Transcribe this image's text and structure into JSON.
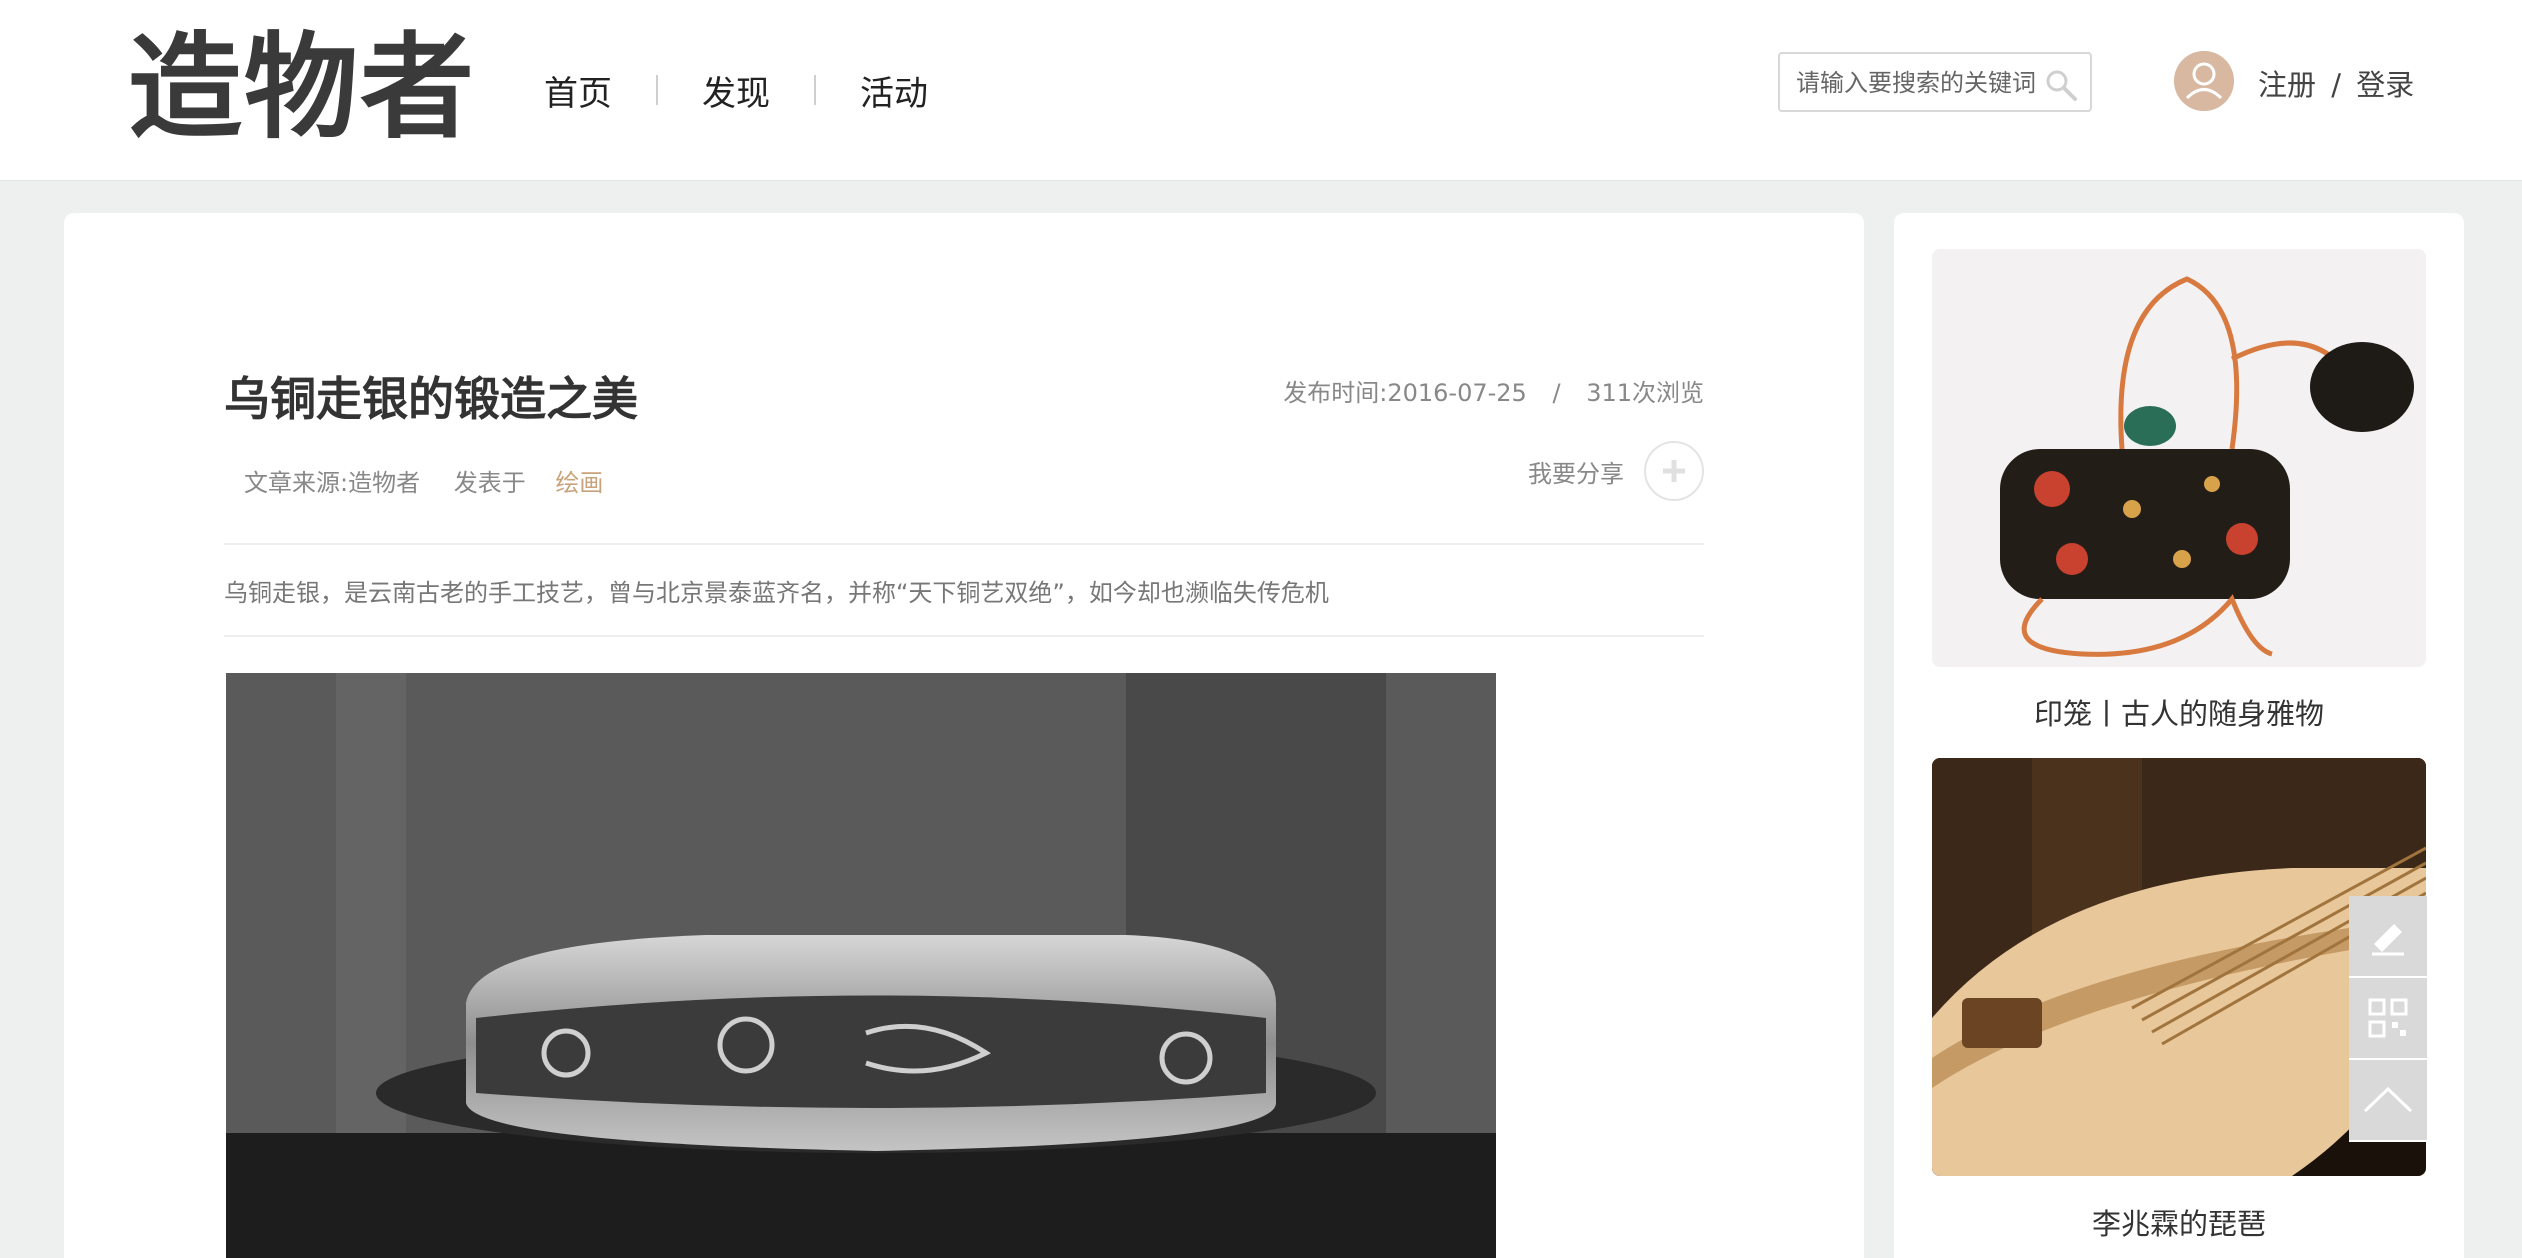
{
  "header": {
    "logo_text": "造物者",
    "nav": [
      "首页",
      "发现",
      "活动"
    ],
    "search": {
      "placeholder": "请输入要搜索的关键词"
    },
    "auth": {
      "register": "注册",
      "separator": "/",
      "login": "登录"
    }
  },
  "article": {
    "title": "乌铜走银的锻造之美",
    "publish_time": "发布时间:2016-07-25",
    "separator": "/",
    "views": "311次浏览",
    "source": "文章来源:造物者",
    "published_in": "发表于",
    "category": "绘画",
    "share_label": "我要分享",
    "summary": "乌铜走银，是云南古老的手工技艺，曾与北京景泰蓝齐名，并称“天下铜艺双绝”，如今却也濒临失传危机"
  },
  "sidebar": {
    "cards": [
      {
        "title": "印笼丨古人的随身雅物"
      },
      {
        "title": "李兆霖的琵琶"
      }
    ]
  },
  "colors": {
    "accent_category": "#c8a27a",
    "float_button": "#d9d9d9",
    "page_bg": "#eef0ef"
  },
  "icons": [
    "search-icon",
    "user-avatar-icon",
    "plus-icon",
    "edit-icon",
    "qr-code-icon",
    "back-to-top-icon"
  ]
}
